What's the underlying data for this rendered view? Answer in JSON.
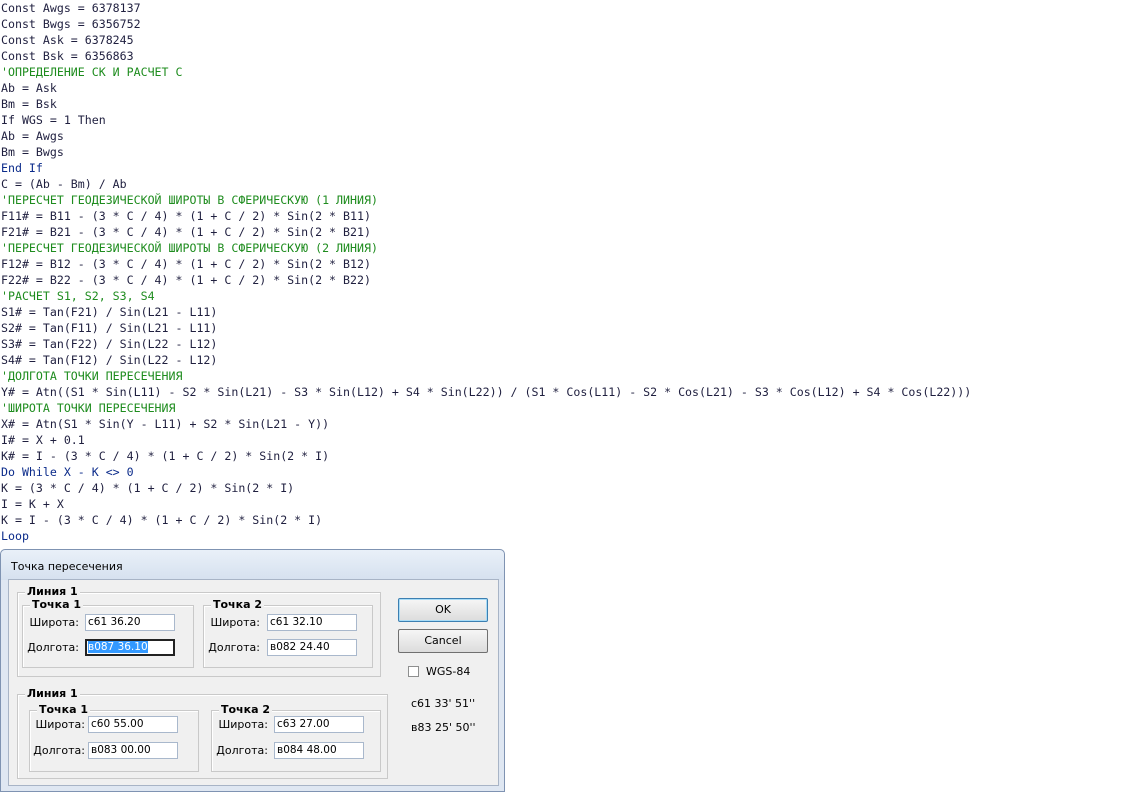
{
  "code_lines": [
    {
      "text": "Const Awgs = 6378137",
      "type": "code"
    },
    {
      "text": "Const Bwgs = 6356752",
      "type": "code"
    },
    {
      "text": "Const Ask = 6378245",
      "type": "code"
    },
    {
      "text": "Const Bsk = 6356863",
      "type": "code"
    },
    {
      "text": "'ОПРЕДЕЛЕНИЕ СК И РАСЧЕТ С",
      "type": "comment"
    },
    {
      "text": "Ab = Ask",
      "type": "code"
    },
    {
      "text": "Bm = Bsk",
      "type": "code"
    },
    {
      "text": "If WGS = 1 Then",
      "type": "code"
    },
    {
      "text": "Ab = Awgs",
      "type": "code"
    },
    {
      "text": "Bm = Bwgs",
      "type": "code"
    },
    {
      "text": "End If",
      "type": "keyword"
    },
    {
      "text": "C = (Ab - Bm) / Ab",
      "type": "code"
    },
    {
      "text": "'ПЕРЕСЧЕТ ГЕОДЕЗИЧЕСКОЙ ШИРОТЫ В СФЕРИЧЕСКУЮ (1 ЛИНИЯ)",
      "type": "comment"
    },
    {
      "text": "F11# = B11 - (3 * C / 4) * (1 + C / 2) * Sin(2 * B11)",
      "type": "code"
    },
    {
      "text": "F21# = B21 - (3 * C / 4) * (1 + C / 2) * Sin(2 * B21)",
      "type": "code"
    },
    {
      "text": "'ПЕРЕСЧЕТ ГЕОДЕЗИЧЕСКОЙ ШИРОТЫ В СФЕРИЧЕСКУЮ (2 ЛИНИЯ)",
      "type": "comment"
    },
    {
      "text": "F12# = B12 - (3 * C / 4) * (1 + C / 2) * Sin(2 * B12)",
      "type": "code"
    },
    {
      "text": "F22# = B22 - (3 * C / 4) * (1 + C / 2) * Sin(2 * B22)",
      "type": "code"
    },
    {
      "text": "'РАСЧЕТ S1, S2, S3, S4",
      "type": "comment"
    },
    {
      "text": "S1# = Tan(F21) / Sin(L21 - L11)",
      "type": "code"
    },
    {
      "text": "S2# = Tan(F11) / Sin(L21 - L11)",
      "type": "code"
    },
    {
      "text": "S3# = Tan(F22) / Sin(L22 - L12)",
      "type": "code"
    },
    {
      "text": "S4# = Tan(F12) / Sin(L22 - L12)",
      "type": "code"
    },
    {
      "text": "'ДОЛГОТА ТОЧКИ ПЕРЕСЕЧЕНИЯ",
      "type": "comment"
    },
    {
      "text": "Y# = Atn((S1 * Sin(L11) - S2 * Sin(L21) - S3 * Sin(L12) + S4 * Sin(L22)) / (S1 * Cos(L11) - S2 * Cos(L21) - S3 * Cos(L12) + S4 * Cos(L22)))",
      "type": "code"
    },
    {
      "text": "'ШИРОТА ТОЧКИ ПЕРЕСЕЧЕНИЯ",
      "type": "comment"
    },
    {
      "text": "X# = Atn(S1 * Sin(Y - L11) + S2 * Sin(L21 - Y))",
      "type": "code"
    },
    {
      "text": "I# = X + 0.1",
      "type": "code"
    },
    {
      "text": "K# = I - (3 * C / 4) * (1 + C / 2) * Sin(2 * I)",
      "type": "code"
    },
    {
      "text": "Do While X - K <> 0",
      "type": "keyword"
    },
    {
      "text": "K = (3 * C / 4) * (1 + C / 2) * Sin(2 * I)",
      "type": "code"
    },
    {
      "text": "I = K + X",
      "type": "code"
    },
    {
      "text": "K = I - (3 * C / 4) * (1 + C / 2) * Sin(2 * I)",
      "type": "code"
    },
    {
      "text": "Loop",
      "type": "keyword"
    }
  ],
  "dialog": {
    "title": "Точка пересечения",
    "line1": {
      "label": "Линия 1",
      "point1": {
        "label": "Точка 1",
        "lat_label": "Широта:",
        "lat_value": "с61 36.20",
        "lon_label": "Долгота:",
        "lon_value": "в087 36.10"
      },
      "point2": {
        "label": "Точка 2",
        "lat_label": "Широта:",
        "lat_value": "с61 32.10",
        "lon_label": "Долгота:",
        "lon_value": "в082 24.40"
      }
    },
    "line2": {
      "label": "Линия 1",
      "point1": {
        "label": "Точка 1",
        "lat_label": "Широта:",
        "lat_value": "с60 55.00",
        "lon_label": "Долгота:",
        "lon_value": "в083 00.00"
      },
      "point2": {
        "label": "Точка 2",
        "lat_label": "Широта:",
        "lat_value": "с63 27.00",
        "lon_label": "Долгота:",
        "lon_value": "в084 48.00"
      }
    },
    "ok_label": "OK",
    "cancel_label": "Cancel",
    "wgs_label": "WGS-84",
    "wgs_checked": false,
    "result_lat": "с61 33' 51''",
    "result_lon": "в83 25' 50''"
  }
}
